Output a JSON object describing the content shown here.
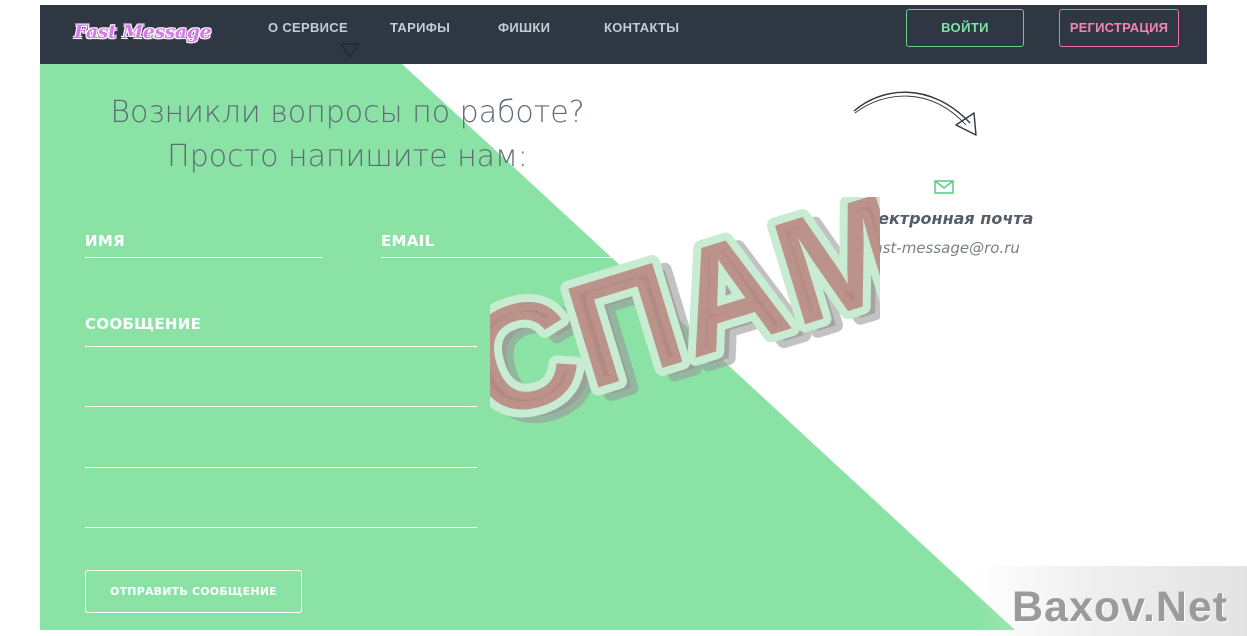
{
  "header": {
    "logo": "Fast Message",
    "nav": [
      {
        "label": "О СЕРВИСЕ"
      },
      {
        "label": "ТАРИФЫ"
      },
      {
        "label": "ФИШКИ"
      },
      {
        "label": "КОНТАКТЫ"
      }
    ],
    "login_label": "ВОЙТИ",
    "register_label": "РЕГИСТРАЦИЯ"
  },
  "contact_form": {
    "heading_line1": "Возникли вопросы по работе?",
    "heading_line2": "Просто напишите нам:",
    "name_label": "ИМЯ",
    "email_label": "EMAIL",
    "message_label": "СООБЩЕНИЕ",
    "submit_label": "ОТПРАВИТЬ СООБЩЕНИЕ"
  },
  "contact_info": {
    "icon": "envelope-icon",
    "title": "Электронная почта",
    "email": "fast-message@ro.ru"
  },
  "overlay": {
    "stamp_text": "СПАМ",
    "watermark_text": "Baxov.Net"
  },
  "colors": {
    "navbar_bg": "#2e3742",
    "green_panel": "#8ae3a5",
    "login_accent": "#63d08c",
    "register_accent": "#f272a8",
    "heading_text": "#5e6b74"
  }
}
